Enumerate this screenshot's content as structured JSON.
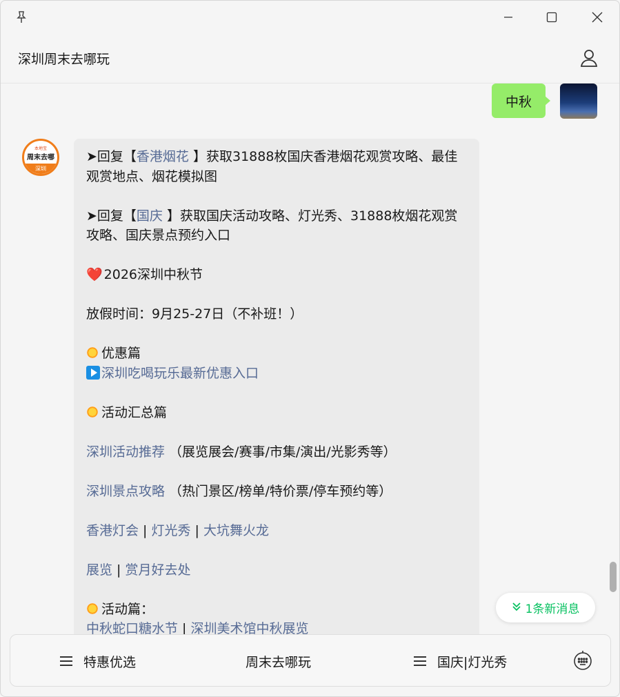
{
  "window": {
    "title": "深圳周末去哪玩"
  },
  "icons": {
    "pin": "pin-icon",
    "minimize": "minimize-icon",
    "maximize": "maximize-icon",
    "close": "close-icon",
    "profile": "person-icon",
    "keyboard": "keyboard-icon"
  },
  "my_message": {
    "text": "中秋"
  },
  "bot_avatar": {
    "top": "本地宝",
    "mid": "周末去哪",
    "bottom": "深圳"
  },
  "bot_message": {
    "p1": {
      "prefix": "➤回复【",
      "link": "香港烟花",
      "suffix": " 】获取31888枚国庆香港烟花观赏攻略、最佳观赏地点、烟花模拟图"
    },
    "p2": {
      "prefix": "➤回复【",
      "link": "国庆",
      "suffix": " 】获取国庆活动攻略、灯光秀、31888枚烟花观赏攻略、国庆景点预约入口"
    },
    "p3": {
      "emoji": "❤️",
      "text": "2026深圳中秋节"
    },
    "p4": {
      "text": "放假时间：9月25-27日（不补班！）"
    },
    "p5": {
      "heading": "优惠篇",
      "link": "深圳吃喝玩乐最新优惠入口"
    },
    "p6": {
      "heading": "活动汇总篇"
    },
    "p7": {
      "link": "深圳活动推荐",
      "text": " （展览展会/赛事/市集/演出/光影秀等）"
    },
    "p8": {
      "link": "深圳景点攻略",
      "text": " （热门景区/榜单/特价票/停车预约等）"
    },
    "p9": {
      "link1": "香港灯会",
      "sep1": " | ",
      "link2": "灯光秀",
      "sep2": " | ",
      "link3": "大坑舞火龙"
    },
    "p10": {
      "link1": "展览",
      "sep1": " | ",
      "link2": "赏月好去处"
    },
    "p11": {
      "heading": "活动篇："
    },
    "p12": {
      "link1": "中秋蛇口糖水节",
      "sep1": " | ",
      "link2": "深圳美术馆中秋展览"
    }
  },
  "new_messages": {
    "label": "1条新消息"
  },
  "bottom_menu": [
    {
      "label": "特惠优选"
    },
    {
      "label": "周末去哪玩"
    },
    {
      "label": "国庆|灯光秀"
    }
  ],
  "colors": {
    "bubble_green": "#95ec69",
    "link_blue": "#576b95",
    "accent_green": "#07c160",
    "avatar_orange": "#f07d1a"
  }
}
